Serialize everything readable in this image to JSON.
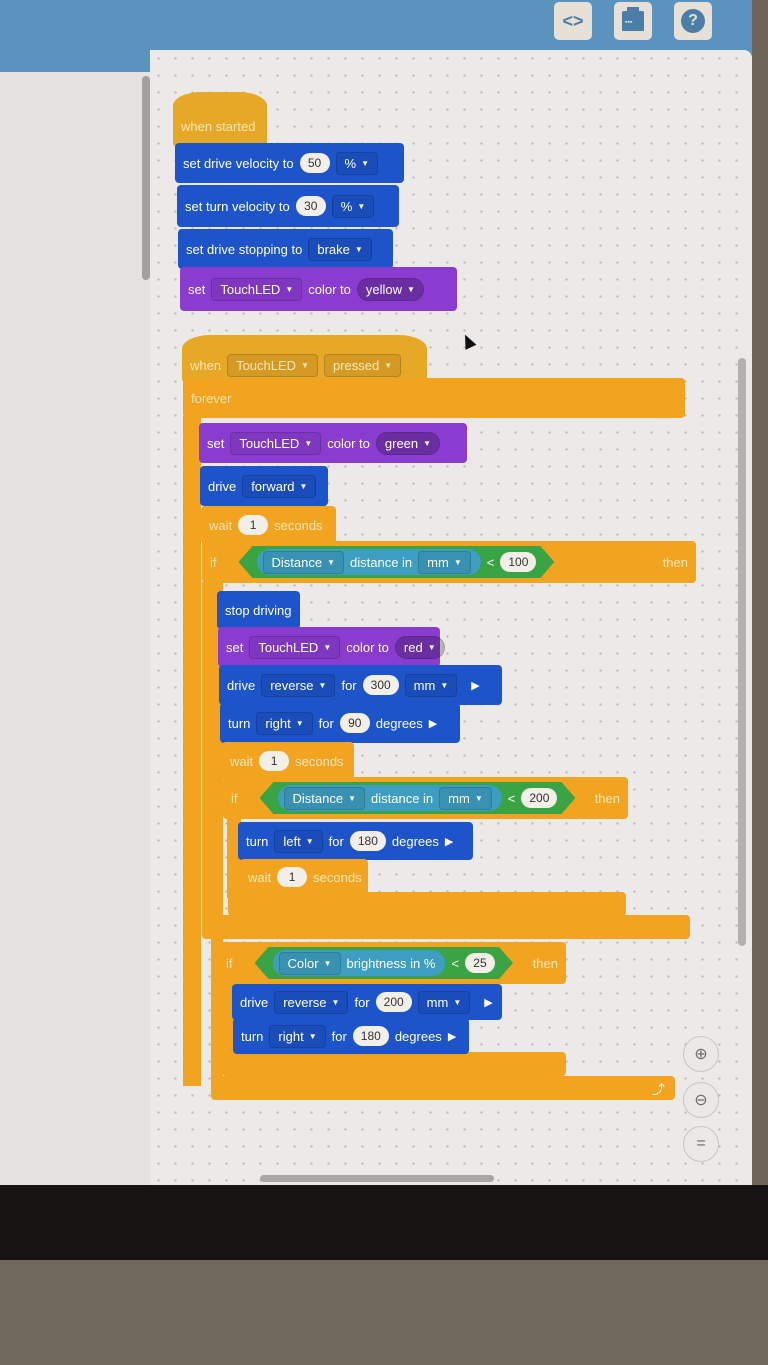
{
  "toolbar": {
    "code_icon_label": "<>",
    "help_icon_label": "?",
    "buttons": [
      "code-view",
      "device",
      "help"
    ]
  },
  "zoom_controls": {
    "zoom_in": "⊕",
    "zoom_out": "⊖",
    "reset": "="
  },
  "colors": {
    "events": "#e6a826",
    "control": "#f2a320",
    "drivetrain": "#1d54c9",
    "looks": "#8a3cd0",
    "operators": "#3aa344",
    "sensing": "#3d9ec1",
    "toolbar": "#5b93bf"
  },
  "script1": {
    "hat": "when started",
    "drive_vel": {
      "label": "set drive velocity to",
      "value": "50",
      "unit": "%"
    },
    "turn_vel": {
      "label": "set turn velocity to",
      "value": "30",
      "unit": "%"
    },
    "stopping": {
      "label": "set drive stopping to",
      "value": "brake"
    },
    "led": {
      "set": "set",
      "device": "TouchLED",
      "color_to": "color to",
      "color": "yellow"
    }
  },
  "script2": {
    "hat": {
      "when": "when",
      "device": "TouchLED",
      "event": "pressed"
    },
    "forever": "forever",
    "led_green": {
      "set": "set",
      "device": "TouchLED",
      "color_to": "color to",
      "color": "green"
    },
    "drive": {
      "label": "drive",
      "dir": "forward"
    },
    "wait1": {
      "label": "wait",
      "value": "1",
      "unit": "seconds"
    },
    "if1": {
      "if": "if",
      "then": "then",
      "sensor": "Distance",
      "reporter": "distance in",
      "unit": "mm",
      "op": "<",
      "value": "100",
      "body": {
        "stop": "stop driving",
        "led_red": {
          "set": "set",
          "device": "TouchLED",
          "color_to": "color to",
          "color": "red"
        },
        "drive_for": {
          "label": "drive",
          "dir": "reverse",
          "for": "for",
          "value": "300",
          "unit": "mm"
        },
        "turn_for": {
          "label": "turn",
          "dir": "right",
          "for": "for",
          "value": "90",
          "unit": "degrees"
        },
        "wait": {
          "label": "wait",
          "value": "1",
          "unit": "seconds"
        },
        "if2": {
          "if": "if",
          "then": "then",
          "sensor": "Distance",
          "reporter": "distance in",
          "unit": "mm",
          "op": "<",
          "value": "200",
          "turn_for": {
            "label": "turn",
            "dir": "left",
            "for": "for",
            "value": "180",
            "unit": "degrees"
          },
          "wait": {
            "label": "wait",
            "value": "1",
            "unit": "seconds"
          }
        }
      }
    },
    "if3": {
      "if": "if",
      "then": "then",
      "sensor": "Color",
      "reporter": "brightness in %",
      "op": "<",
      "value": "25",
      "drive_for": {
        "label": "drive",
        "dir": "reverse",
        "for": "for",
        "value": "200",
        "unit": "mm"
      },
      "turn_for": {
        "label": "turn",
        "dir": "right",
        "for": "for",
        "value": "180",
        "unit": "degrees"
      }
    },
    "loop_arrow": "⤴"
  }
}
